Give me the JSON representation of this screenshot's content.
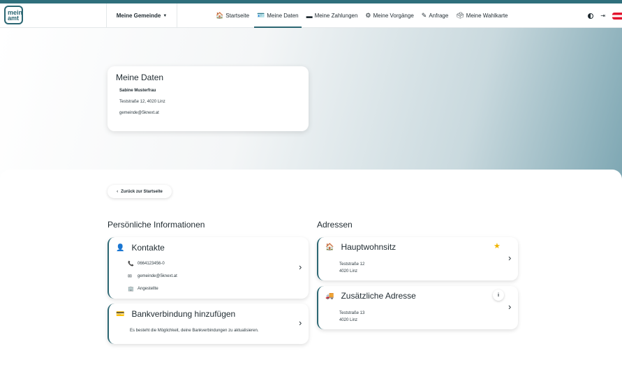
{
  "brand": {
    "logo_line1": "mein",
    "logo_line2": "amt"
  },
  "header": {
    "municipality_label": "Meine Gemeinde"
  },
  "nav": {
    "items": [
      {
        "label": "Startseite",
        "icon": "home-icon",
        "glyph": "🏠"
      },
      {
        "label": "Meine Daten",
        "icon": "id-card-icon",
        "glyph": "🪪",
        "active": true
      },
      {
        "label": "Meine Zahlungen",
        "icon": "credit-card-icon",
        "glyph": "▬"
      },
      {
        "label": "Meine Vorgänge",
        "icon": "gears-icon",
        "glyph": "⚙"
      },
      {
        "label": "Anfrage",
        "icon": "file-signature-icon",
        "glyph": "✎"
      },
      {
        "label": "Meine Wahlkarte",
        "icon": "ballot-icon",
        "glyph": "🗳"
      }
    ]
  },
  "profile": {
    "title": "Meine Daten",
    "name": "Sabine Musterfrau",
    "address": "Teststraße 12, 4020 Linz",
    "email": "gemeinde@5knext.at"
  },
  "back_label": "Zurück zur Startseite",
  "personal": {
    "title": "Persönliche Informationen",
    "contacts": {
      "title": "Kontakte",
      "phone": "0664123456-0",
      "email": "gemeinde@5knext.at",
      "occupation": "Angestellte"
    },
    "bank": {
      "title": "Bankverbindung hinzufügen",
      "description": "Es besteht die Möglichkeit, deine Bankverbindungen zu aktualisieren."
    }
  },
  "addresses": {
    "title": "Adressen",
    "main": {
      "title": "Hauptwohnsitz",
      "street": "Teststraße 12",
      "city": "4020 Linz"
    },
    "extra": {
      "title": "Zusätzliche Adresse",
      "street": "Teststraße 13",
      "city": "4020 Linz",
      "info": "i"
    }
  },
  "colors": {
    "accent": "#2b6672",
    "star": "#f0b400",
    "flag_red": "#e3152e"
  }
}
